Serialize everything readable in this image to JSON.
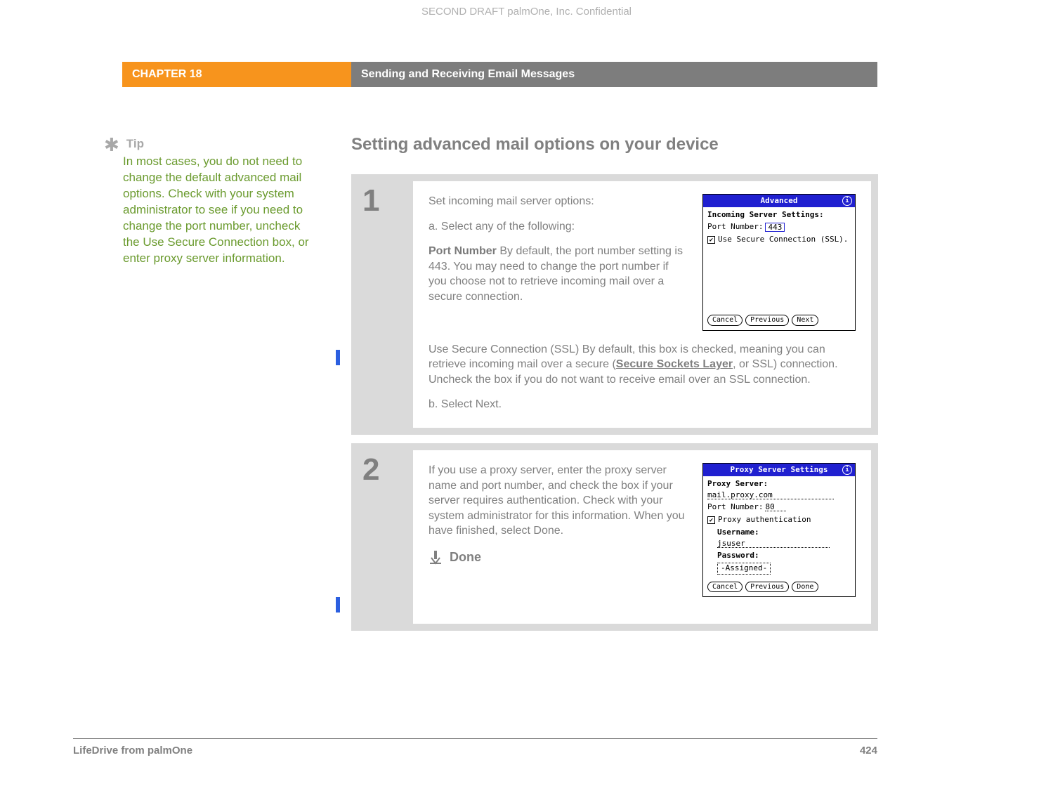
{
  "watermark": "SECOND DRAFT palmOne, Inc.  Confidential",
  "header": {
    "chapter": "CHAPTER 18",
    "title": "Sending and Receiving Email Messages"
  },
  "tip": {
    "label": "Tip",
    "body": "In most cases, you do not need to change the default advanced mail options. Check with your system administrator to see if you need to change the port number, uncheck the Use Secure Connection box, or enter proxy server information."
  },
  "section_title": "Setting advanced mail options on your device",
  "step1": {
    "num": "1",
    "intro": "Set incoming mail server options:",
    "a_label": "a.  Select any of the following:",
    "port_label": "Port Number",
    "port_text": "   By default, the port number setting is 443. You may need to change the port number if you choose not to retrieve incoming mail over a secure connection.",
    "ssl_label": "Use Secure Connection (SSL)",
    "ssl_text_pre": "   By default, this box is checked, meaning you can retrieve incoming mail over a secure (",
    "ssl_link": "Secure Sockets Layer",
    "ssl_text_post": ", or SSL) connection. Uncheck the box if you do not want to receive email over an SSL connection.",
    "b_label": "b.  Select Next.",
    "dialog": {
      "title": "Advanced",
      "section": "Incoming Server Settings:",
      "port_label": "Port Number:",
      "port_value": "443",
      "ssl_label": "Use Secure Connection (SSL).",
      "btn_cancel": "Cancel",
      "btn_prev": "Previous",
      "btn_next": "Next"
    }
  },
  "step2": {
    "num": "2",
    "body": "If you use a proxy server, enter the proxy server name and port number, and check the box if your server requires authentication. Check with your system administrator for this information. When you have finished, select Done.",
    "done": "Done",
    "dialog": {
      "title": "Proxy Server Settings",
      "section": "Proxy Server:",
      "server_value": "mail.proxy.com",
      "port_label": "Port Number:",
      "port_value": "80",
      "auth_label": "Proxy authentication",
      "user_label": "Username:",
      "user_value": "jsuser",
      "pass_label": "Password:",
      "pass_value": "-Assigned-",
      "btn_cancel": "Cancel",
      "btn_prev": "Previous",
      "btn_done": "Done"
    }
  },
  "footer": {
    "product": "LifeDrive from palmOne",
    "page": "424"
  }
}
